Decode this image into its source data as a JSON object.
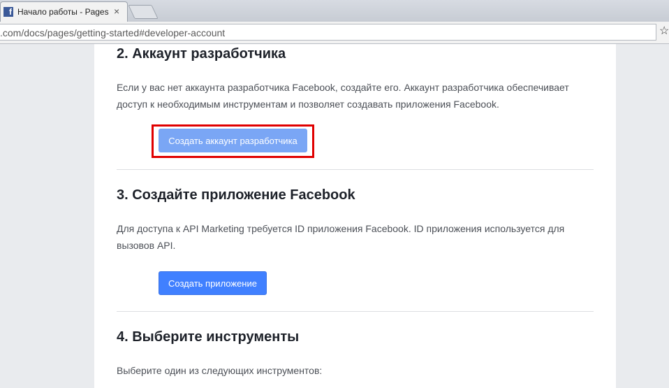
{
  "browser": {
    "tab_title": "Начало работы - Pages",
    "tab_close": "×",
    "url": ".com/docs/pages/getting-started#developer-account",
    "star": "☆"
  },
  "sections": {
    "developer_account": {
      "heading": "2. Аккаунт разработчика",
      "text_line1": "Если у вас нет аккаунта разработчика Facebook, создайте его. Аккаунт разработчика обеспечивает",
      "text_line2": "доступ к необходимым инструментам и позволяет создавать приложения Facebook.",
      "button_label": "Создать аккаунт разработчика"
    },
    "create_app": {
      "heading": "3. Создайте приложение Facebook",
      "text_line1": "Для доступа к API Marketing требуется ID приложения Facebook. ID приложения используется для",
      "text_line2": "вызовов API.",
      "button_label": "Создать приложение"
    },
    "choose_tools": {
      "heading": "4. Выберите инструменты",
      "text": "Выберите один из следующих инструментов:"
    }
  },
  "colors": {
    "primary_button": "#4080ff",
    "disabled_button": "#7aa6f5",
    "highlight": "#e00000",
    "facebook_blue": "#3b5998"
  }
}
